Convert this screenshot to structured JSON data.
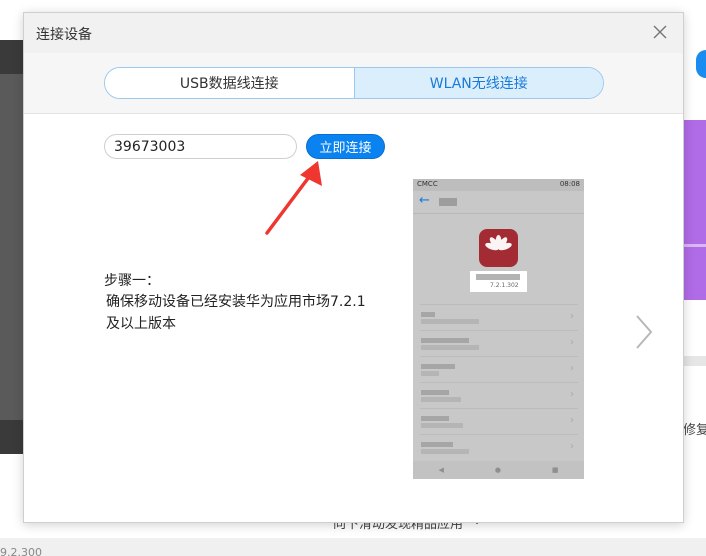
{
  "dialog": {
    "title": "连接设备",
    "close_icon": "close-icon"
  },
  "tabs": [
    {
      "label": "USB数据线连接",
      "selected": false
    },
    {
      "label": "WLAN无线连接",
      "selected": true
    }
  ],
  "connect": {
    "code_value": "39673003",
    "button_label": "立即连接"
  },
  "instructions": {
    "step_title": "步骤一：",
    "step_text": "确保移动设备已经安装华为应用市场7.2.1及以上版本"
  },
  "phone_preview": {
    "carrier": "CMCC",
    "time": "08:08",
    "app_version": "7.2.1.302"
  },
  "background": {
    "partial_text_right": "修复",
    "bottom_text": "向下滑动发现精品应用",
    "version_text": "9.2.300"
  },
  "colors": {
    "accent": "#0a82f0",
    "tab_selected_bg": "#dbeefc",
    "arrow": "#f0372f",
    "app_icon": "#a32b34"
  }
}
